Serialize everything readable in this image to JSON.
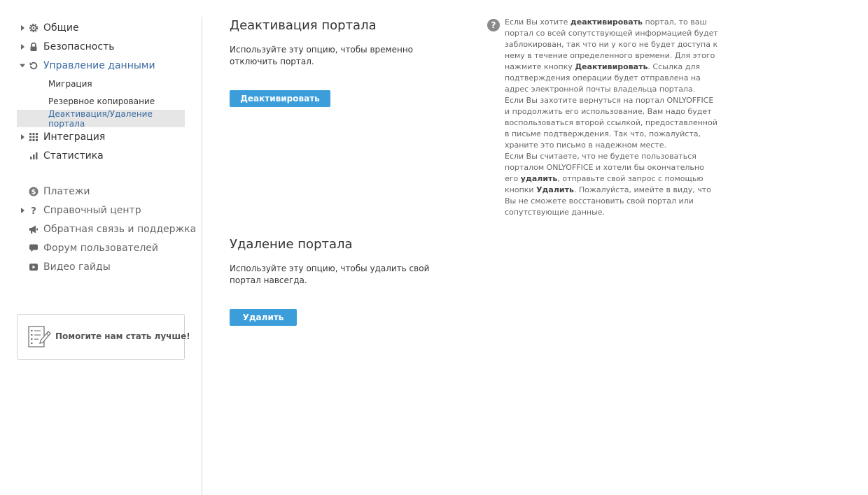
{
  "sidebar": {
    "general": "Общие",
    "security": "Безопасность",
    "data_management": "Управление данными",
    "sub": {
      "migration": "Миграция",
      "backup": "Резервное копирование",
      "deactivation": "Деактивация/Удаление портала"
    },
    "integration": "Интеграция",
    "statistics": "Статистика",
    "payments": "Платежи",
    "help_center": "Справочный центр",
    "feedback": "Обратная связь и поддержка",
    "forum": "Форум пользователей",
    "video": "Видео гайды",
    "help_us": "Помогите нам стать лучше!"
  },
  "main": {
    "deactivate": {
      "title": "Деактивация портала",
      "desc": "Используйте эту опцию, чтобы временно отключить портал.",
      "button": "Деактивировать"
    },
    "delete": {
      "title": "Удаление портала",
      "desc": "Используйте эту опцию, чтобы удалить свой портал навсегда.",
      "button": "Удалить"
    }
  },
  "info": {
    "icon": "?",
    "p1_a": "Если Вы хотите ",
    "p1_b": "деактивировать",
    "p1_c": " портал, то ваш портал со всей сопутствующей информацией будет заблокирован, так что ни у кого не будет доступа к нему в течение определенного времени. Для этого нажмите кнопку ",
    "p1_d": "Деактивировать",
    "p1_e": ". Ссылка для подтверждения операции будет отправлена на адрес электронной почты владельца портала.",
    "p2": "Если Вы захотите вернуться на портал ONLYOFFICE и продолжить его использование, Вам надо будет воспользоваться второй ссылкой, предоставленной в письме подтверждения. Так что, пожалуйста, храните это письмо в надежном месте.",
    "p3_a": "Если Вы считаете, что не будете пользоваться порталом ONLYOFFICE и хотели бы окончательно его ",
    "p3_b": "удалить",
    "p3_c": ", отправьте свой запрос с помощью кнопки ",
    "p3_d": "Удалить",
    "p3_e": ". Пожалуйста, имейте в виду, что Вы не сможете восстановить свой портал или сопутствующие данные."
  }
}
